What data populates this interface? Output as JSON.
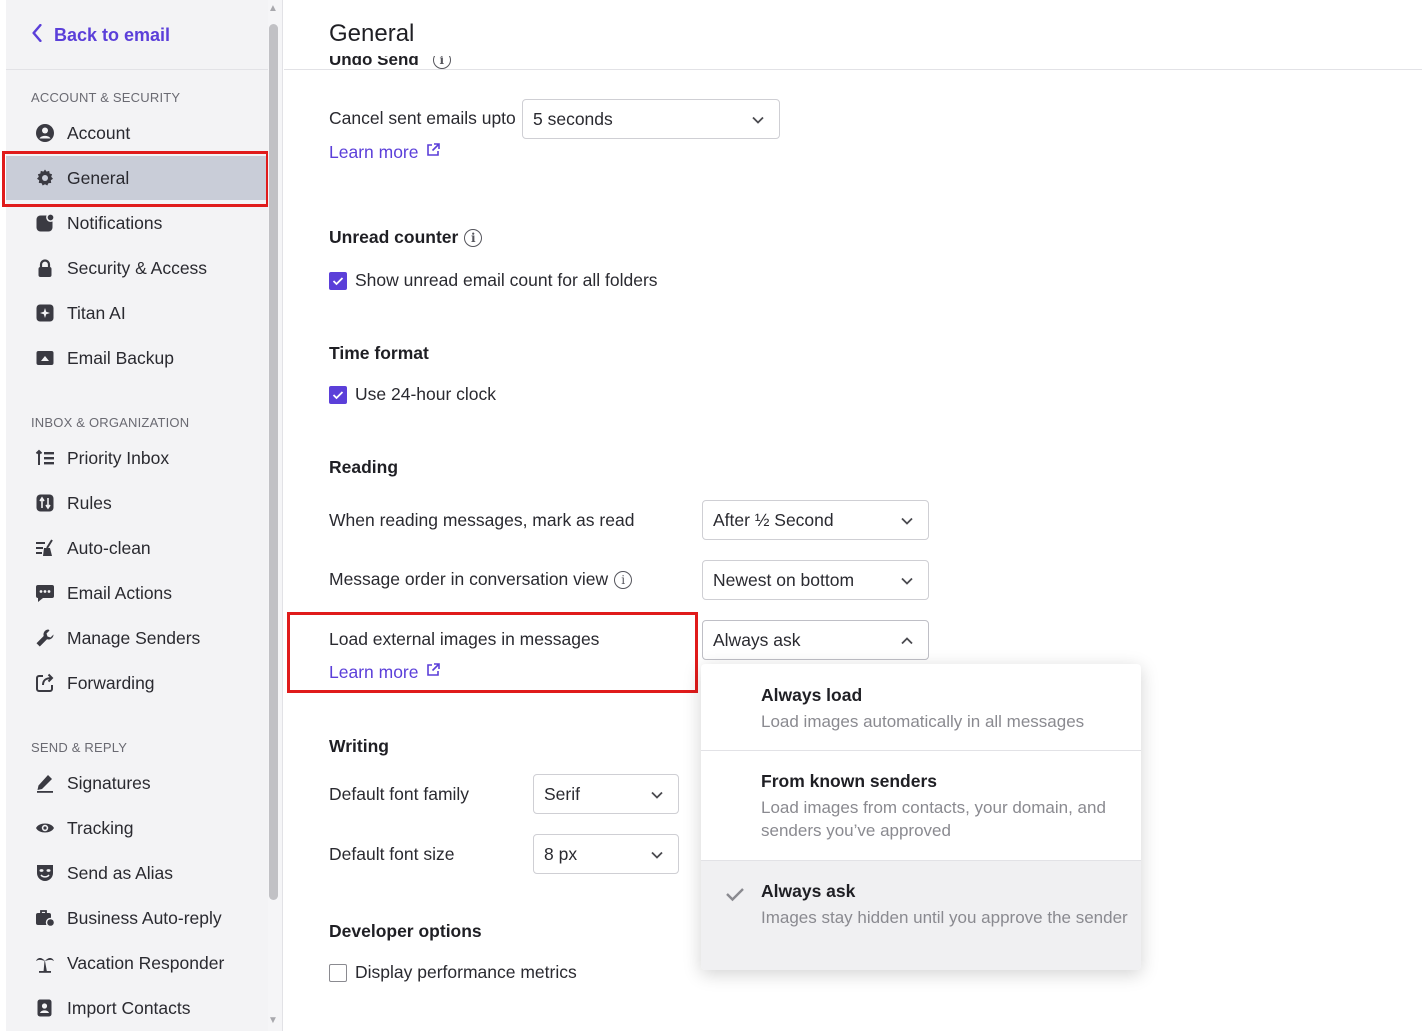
{
  "sidebar": {
    "back_label": "Back to email",
    "sections": {
      "account": "ACCOUNT & SECURITY",
      "inbox": "INBOX & ORGANIZATION",
      "send": "SEND & REPLY"
    },
    "items": {
      "account": "Account",
      "general": "General",
      "notifications": "Notifications",
      "security": "Security & Access",
      "titan_ai": "Titan AI",
      "email_backup": "Email Backup",
      "priority_inbox": "Priority Inbox",
      "rules": "Rules",
      "auto_clean": "Auto-clean",
      "email_actions": "Email Actions",
      "manage_senders": "Manage Senders",
      "forwarding": "Forwarding",
      "signatures": "Signatures",
      "tracking": "Tracking",
      "send_as_alias": "Send as Alias",
      "business_auto_reply": "Business Auto-reply",
      "vacation_responder": "Vacation Responder",
      "import_contacts": "Import Contacts"
    },
    "active_item": "General"
  },
  "main": {
    "title": "General",
    "undo_send": {
      "heading": "Undo Send",
      "label": "Cancel sent emails upto",
      "value": "5 seconds",
      "learn_more": "Learn more"
    },
    "unread_counter": {
      "heading": "Unread counter",
      "checkbox_label": "Show unread email count for all folders",
      "checked": true
    },
    "time_format": {
      "heading": "Time format",
      "checkbox_label": "Use 24-hour clock",
      "checked": true
    },
    "reading": {
      "heading": "Reading",
      "mark_read_label": "When reading messages, mark as read",
      "mark_read_value": "After ½ Second",
      "order_label": "Message order in conversation view",
      "order_value": "Newest on bottom",
      "images_label": "Load external images in messages",
      "images_value": "Always ask",
      "images_learn_more": "Learn more"
    },
    "writing": {
      "heading": "Writing",
      "font_family_label": "Default font family",
      "font_family_value": "Serif",
      "font_size_label": "Default font size",
      "font_size_value": "8 px"
    },
    "developer": {
      "heading": "Developer options",
      "checkbox_label": "Display performance metrics",
      "checked": false
    }
  },
  "images_menu": {
    "options": [
      {
        "title": "Always load",
        "desc": "Load images automatically in all messages",
        "selected": false
      },
      {
        "title": "From known senders",
        "desc": "Load images from contacts, your domain, and senders you’ve approved",
        "selected": false
      },
      {
        "title": "Always ask",
        "desc": "Images stay hidden until you approve the sender",
        "selected": true
      }
    ]
  },
  "colors": {
    "accent": "#5b3fd9",
    "highlight": "#e01b1b",
    "active_nav": "#c9cdd8",
    "sidebar_bg": "#f3f3f5"
  }
}
